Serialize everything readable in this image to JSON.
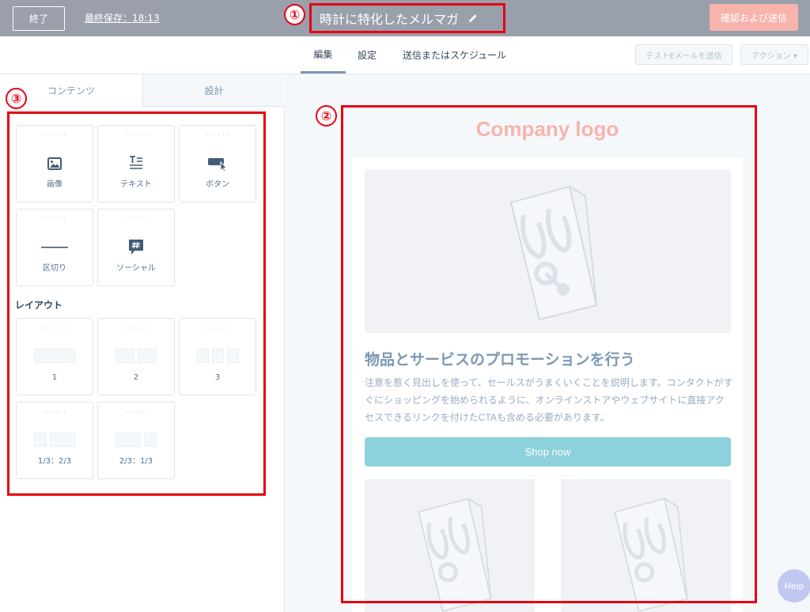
{
  "topbar": {
    "exit_label": "終了",
    "last_saved": "最終保存：18:13",
    "email_title": "時計に特化したメルマガ",
    "review_send_label": "確認および送信"
  },
  "callouts": {
    "one": "①",
    "two": "②",
    "three": "③"
  },
  "tabs": [
    {
      "label": "編集",
      "active": true
    },
    {
      "label": "設定",
      "active": false
    },
    {
      "label": "送信またはスケジュール",
      "active": false
    }
  ],
  "actions": {
    "test_email_label": "テストEメールを送信",
    "action_label": "アクション ▾"
  },
  "left_panel": {
    "tab_contents": "コンテンツ",
    "tab_design": "設計",
    "modules": [
      {
        "label": "画像",
        "icon": "image-icon"
      },
      {
        "label": "テキスト",
        "icon": "text-icon"
      },
      {
        "label": "ボタン",
        "icon": "button-icon"
      },
      {
        "label": "区切り",
        "icon": "divider-icon"
      },
      {
        "label": "ソーシャル",
        "icon": "social-hash-icon"
      }
    ],
    "layout_heading": "レイアウト",
    "layouts": [
      {
        "label": "1"
      },
      {
        "label": "2"
      },
      {
        "label": "3"
      },
      {
        "label": "1/3：2/3"
      },
      {
        "label": "2/3：1/3"
      }
    ],
    "grip": "::::::"
  },
  "preview": {
    "logo_text": "Company logo",
    "heading": "物品とサービスのプロモーションを行う",
    "body_text": "注意を惹く見出しを使って、セールスがうまくいくことを説明します。コンタクトがすぐにショッピングを始められるように、オンラインストアやウェブサイトに直接アクセスできるリンクを付けたCTAも含める必要があります。",
    "cta_label": "Shop now"
  },
  "help_label": "Help",
  "colors": {
    "topbar": "#99a0ab",
    "primary_button": "#f8b3ad",
    "annotation_red": "#e60012",
    "cta": "#8dd1dd"
  }
}
